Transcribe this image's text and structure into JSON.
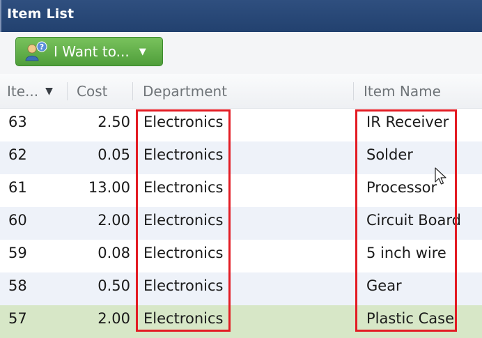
{
  "window": {
    "title": "Item List"
  },
  "toolbar": {
    "menu_label": "I Want to...",
    "menu_icon": "users-question-icon",
    "caret_icon": "caret-down-icon"
  },
  "grid": {
    "columns": {
      "id": "Ite...",
      "cost": "Cost",
      "department": "Department",
      "item_name": "Item Name"
    },
    "sort": {
      "column": "id",
      "direction": "descending"
    },
    "rows": [
      {
        "id": "63",
        "cost": "2.50",
        "department": "Electronics",
        "item_name": "IR Receiver"
      },
      {
        "id": "62",
        "cost": "0.05",
        "department": "Electronics",
        "item_name": "Solder"
      },
      {
        "id": "61",
        "cost": "13.00",
        "department": "Electronics",
        "item_name": "Processor"
      },
      {
        "id": "60",
        "cost": "2.00",
        "department": "Electronics",
        "item_name": "Circuit Board"
      },
      {
        "id": "59",
        "cost": "0.08",
        "department": "Electronics",
        "item_name": "5 inch wire"
      },
      {
        "id": "58",
        "cost": "0.50",
        "department": "Electronics",
        "item_name": "Gear"
      },
      {
        "id": "57",
        "cost": "2.00",
        "department": "Electronics",
        "item_name": "Plastic Case"
      }
    ],
    "selected_row_index": 6
  },
  "colors": {
    "title_bar": "#2a4876",
    "button_green": "#5aa843",
    "row_alt": "#eef2f9",
    "row_selected": "#d7e7c7",
    "highlight_box": "#e31b23"
  }
}
